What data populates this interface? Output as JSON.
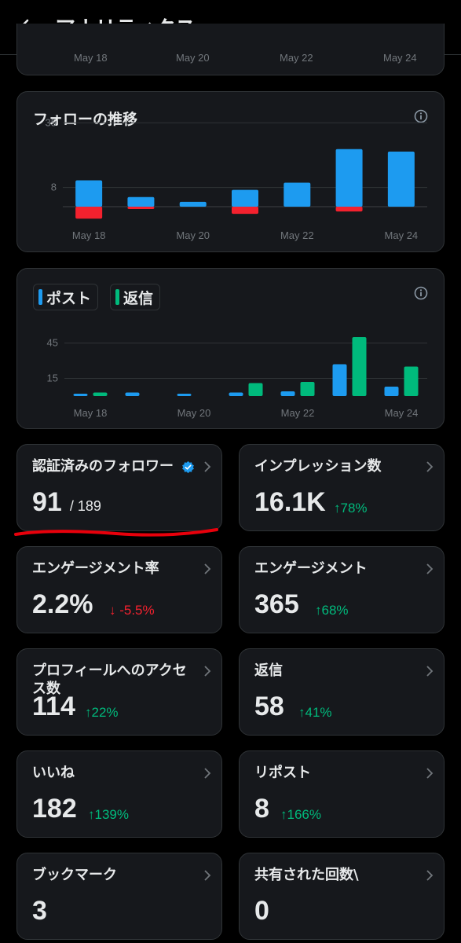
{
  "header": {
    "title": "アナリティクス"
  },
  "top_chart": {
    "x_labels": [
      "May 18",
      "May 20",
      "May 22",
      "May 24"
    ]
  },
  "followers_chart": {
    "title": "フォローの推移",
    "chart_data": {
      "type": "bar",
      "categories": [
        "May 18",
        "May 19",
        "May 20",
        "May 21",
        "May 22",
        "May 23",
        "May 24"
      ],
      "x_tick_labels": [
        "May 18",
        "May 20",
        "May 22",
        "May 24"
      ],
      "y_ticks": [
        "35",
        "8"
      ],
      "series": [
        {
          "values": [
            11,
            4,
            2,
            7,
            10,
            24,
            23
          ],
          "color": "#1d9bf0"
        },
        {
          "values": [
            -5,
            -1,
            0,
            -3,
            0,
            -2,
            0
          ],
          "color": "#f4212e"
        }
      ]
    }
  },
  "posts_chart": {
    "legend": {
      "posts": "ポスト",
      "replies": "返信"
    },
    "chart_data": {
      "type": "bar",
      "categories": [
        "May 18",
        "May 19",
        "May 20",
        "May 21",
        "May 22",
        "May 23",
        "May 24"
      ],
      "x_tick_labels": [
        "May 18",
        "May 20",
        "May 22",
        "May 24"
      ],
      "y_ticks": [
        "45",
        "15"
      ],
      "series": [
        {
          "name": "ポスト",
          "values": [
            2,
            3,
            2,
            3,
            4,
            27,
            8
          ],
          "color": "#1d9bf0"
        },
        {
          "name": "返信",
          "values": [
            3,
            0,
            0,
            11,
            12,
            50,
            25
          ],
          "color": "#00ba7c"
        }
      ]
    }
  },
  "metrics": {
    "verified_followers": {
      "label": "認証済みのフォロワー",
      "value": "91",
      "sub": "/ 189"
    },
    "impressions": {
      "label": "インプレッション数",
      "value": "16.1K",
      "change": "↑78%"
    },
    "engagement_rate": {
      "label": "エンゲージメント率",
      "value": "2.2%",
      "change": "↓ -5.5%"
    },
    "engagements": {
      "label": "エンゲージメント",
      "value": "365",
      "change": "↑68%"
    },
    "profile_visits": {
      "label": "プロフィールへのアクセス数",
      "value": "114",
      "change": "↑22%"
    },
    "replies": {
      "label": "返信",
      "value": "58",
      "change": "↑41%"
    },
    "likes": {
      "label": "いいね",
      "value": "182",
      "change": "↑139%"
    },
    "reposts": {
      "label": "リポスト",
      "value": "8",
      "change": "↑166%"
    },
    "bookmarks": {
      "label": "ブックマーク",
      "value": "3"
    },
    "shares": {
      "label": "共有された回数\\",
      "value": "0"
    }
  },
  "colors": {
    "accent": "#1d9bf0",
    "positive": "#00ba7c",
    "negative": "#f4212e",
    "annotation": "#e8000b"
  }
}
